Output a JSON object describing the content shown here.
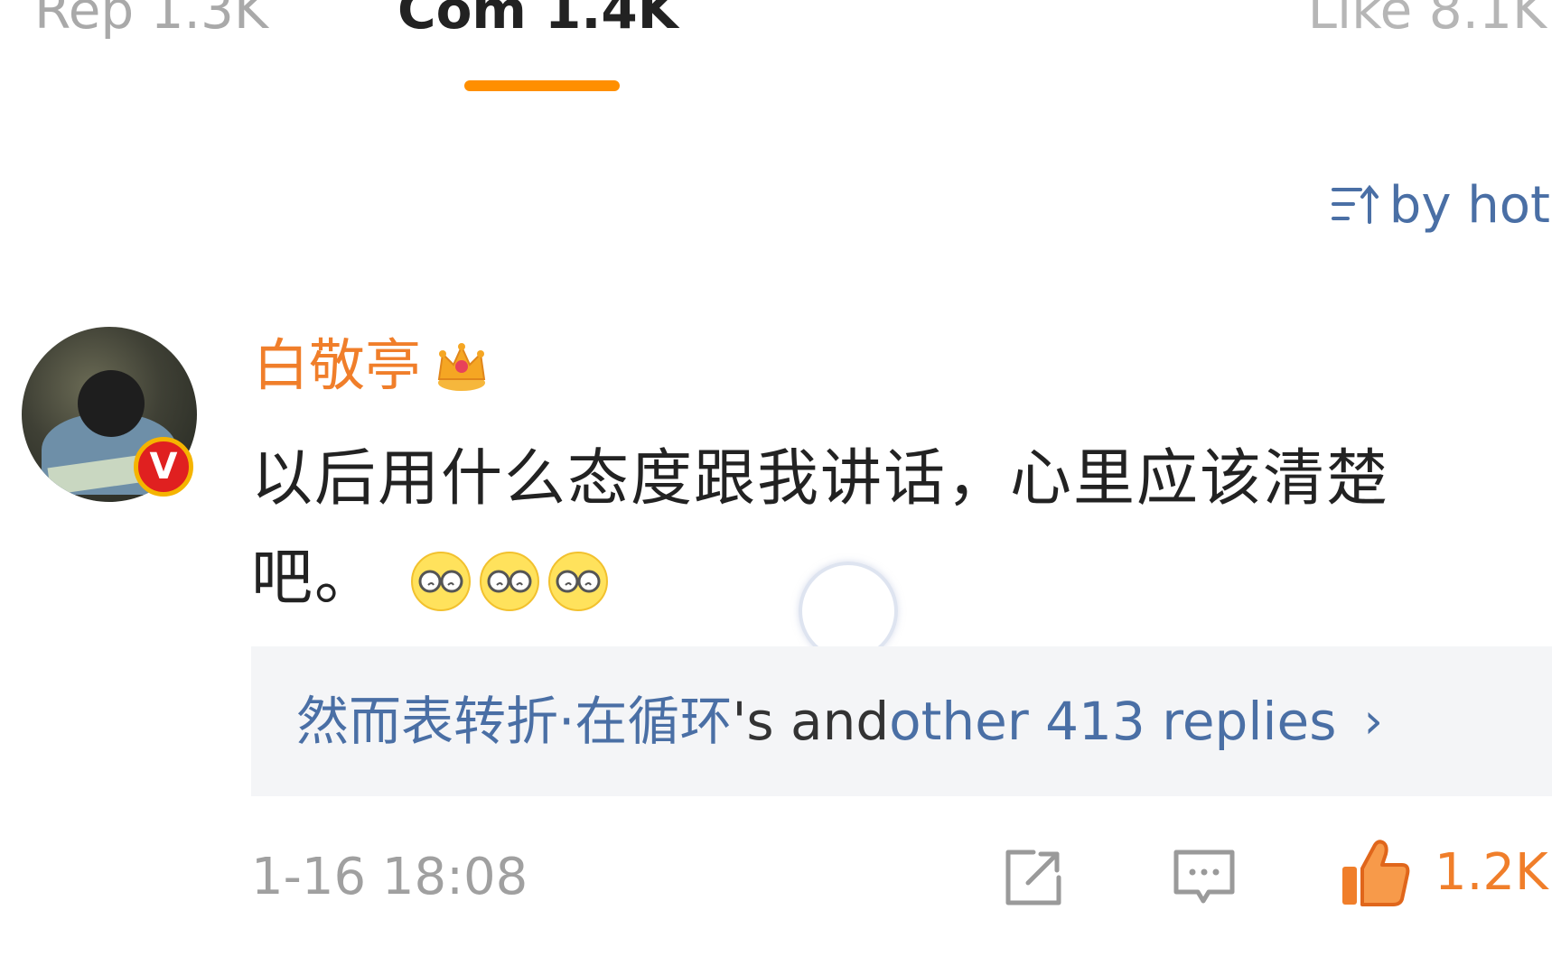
{
  "tabs": [
    {
      "label": "Rep 1.3K"
    },
    {
      "label": "Com 1.4K",
      "active": true
    },
    {
      "label": "Like 8.1K"
    }
  ],
  "sort": {
    "label": "by hot",
    "icon": "sort-icon"
  },
  "comment": {
    "username": "白敬亭",
    "badge_icon": "crown-icon",
    "verified_label": "V",
    "text": "以后用什么态度跟我讲话，心里应该清楚吧。",
    "emojis": [
      "glasses-emoji",
      "glasses-emoji",
      "glasses-emoji"
    ],
    "replies": {
      "user": "然而表转折·在循环",
      "connector": "'s and ",
      "others": "other 413 replies",
      "chevron": "›"
    },
    "timestamp": "1-16 18:08",
    "likes": "1.2K"
  },
  "colors": {
    "accent": "#ff8f00",
    "username": "#f07e2a",
    "link": "#4a6fa5",
    "muted": "#a0a0a0"
  }
}
